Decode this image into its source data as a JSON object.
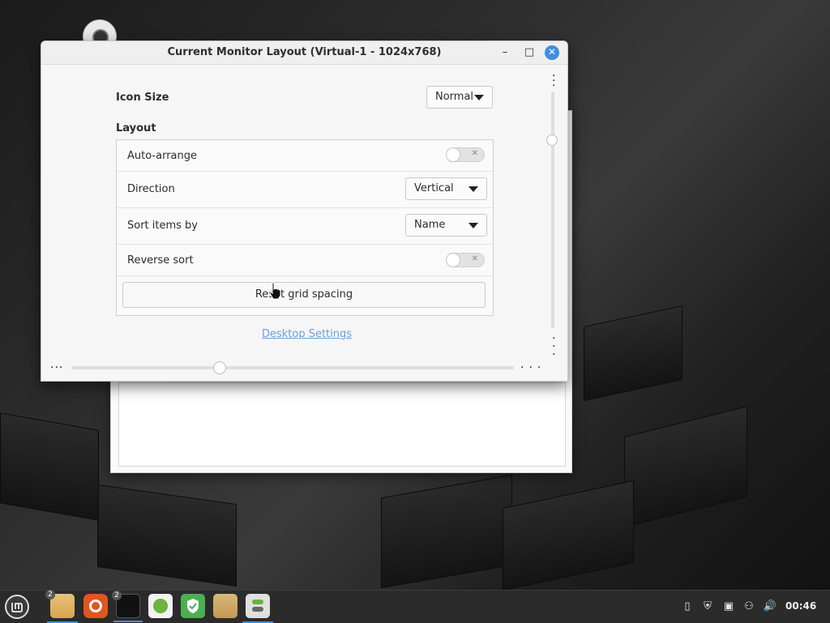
{
  "window": {
    "title": "Current Monitor Layout (Virtual-1 - 1024x768)",
    "minimize": "–",
    "maximize": "□",
    "close": "✕"
  },
  "icon_size": {
    "label": "Icon Size",
    "value": "Normal"
  },
  "layout": {
    "heading": "Layout",
    "auto_arrange": {
      "label": "Auto-arrange",
      "enabled": false
    },
    "direction": {
      "label": "Direction",
      "value": "Vertical"
    },
    "sort": {
      "label": "Sort items by",
      "value": "Name"
    },
    "reverse_sort": {
      "label": "Reverse sort",
      "enabled": false
    },
    "reset_button": "Reset grid spacing"
  },
  "link": "Desktop Settings",
  "taskbar": {
    "badges": {
      "files": "2",
      "terminal": "2"
    },
    "clock": "00:46"
  },
  "colors": {
    "accent": "#3d8fe0",
    "link": "#6ca0d8"
  }
}
